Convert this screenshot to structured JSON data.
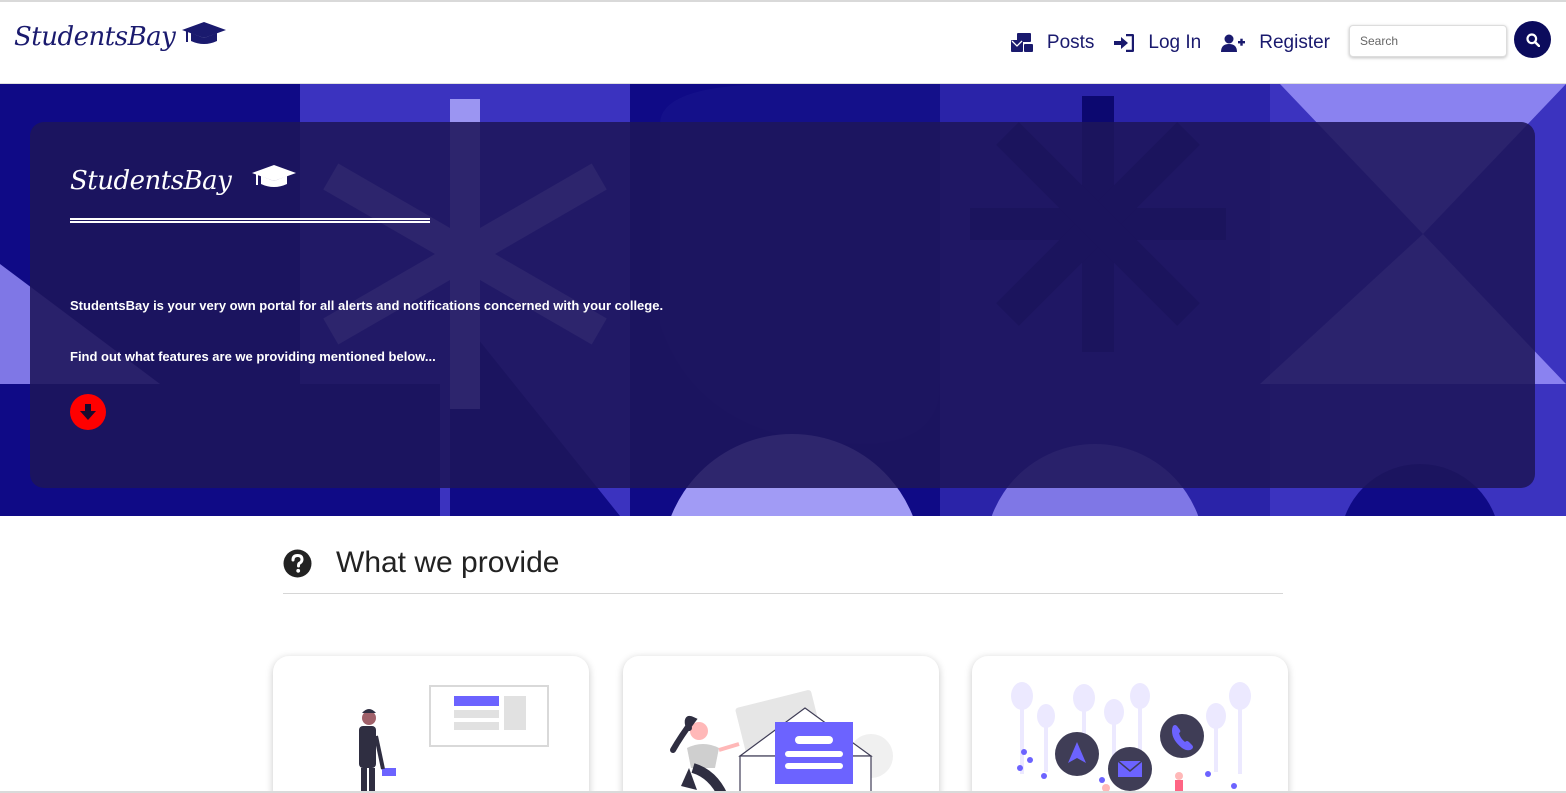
{
  "navbar": {
    "brand": "StudentsBay",
    "links": [
      {
        "label": "Posts",
        "icon": "mail-bulk-icon"
      },
      {
        "label": "Log In",
        "icon": "sign-in-icon"
      },
      {
        "label": "Register",
        "icon": "user-plus-icon"
      }
    ],
    "search": {
      "placeholder": "Search",
      "value": ""
    },
    "search_button_icon": "search-icon"
  },
  "hero": {
    "brand": "StudentsBay",
    "line1": "StudentsBay is your very own portal for all alerts and notifications concerned with your college.",
    "line2": "Find out what features are we providing mentioned below...",
    "scroll_button_icon": "arrow-down-icon"
  },
  "section": {
    "title": "What we provide",
    "icon": "question-circle-icon"
  },
  "colors": {
    "brand_navy": "#1a1a6e",
    "hero_bg": "#1c1591",
    "accent_purple": "#6c63ff",
    "alert_red": "#ff0000"
  }
}
